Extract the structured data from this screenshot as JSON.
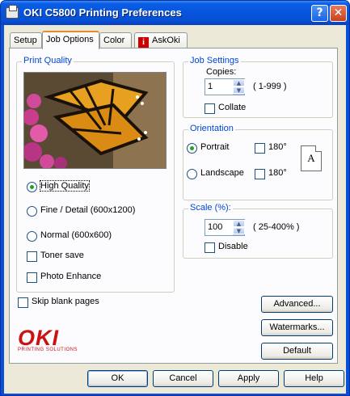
{
  "window": {
    "title": "OKI C5800 Printing Preferences",
    "help_glyph": "?",
    "close_glyph": "✕"
  },
  "tabs": [
    {
      "label": "Setup",
      "active": false
    },
    {
      "label": "Job Options",
      "active": true
    },
    {
      "label": "Color",
      "active": false
    },
    {
      "label": "AskOki",
      "active": false,
      "icon": "info-icon",
      "icon_glyph": "i"
    }
  ],
  "print_quality": {
    "title": "Print Quality",
    "options": [
      {
        "label": "High Quality",
        "selected": true
      },
      {
        "label": "Fine / Detail (600x1200)",
        "selected": false
      },
      {
        "label": "Normal (600x600)",
        "selected": false
      }
    ],
    "toner_save": {
      "label": "Toner save",
      "checked": false
    },
    "photo_enhance": {
      "label": "Photo Enhance",
      "checked": false
    }
  },
  "job_settings": {
    "title": "Job Settings",
    "copies_label": "Copies:",
    "copies_value": "1",
    "copies_range": "( 1-999 )",
    "collate": {
      "label": "Collate",
      "checked": false
    }
  },
  "orientation": {
    "title": "Orientation",
    "portrait": {
      "label": "Portrait",
      "selected": true
    },
    "landscape": {
      "label": "Landscape",
      "selected": false
    },
    "rotate_portrait": {
      "label": "180°",
      "checked": false
    },
    "rotate_landscape": {
      "label": "180°",
      "checked": false
    },
    "preview_glyph": "A"
  },
  "scale": {
    "title": "Scale (%):",
    "value": "100",
    "range": "( 25-400% )",
    "disable": {
      "label": "Disable",
      "checked": false
    }
  },
  "skip_blank": {
    "label": "Skip blank pages",
    "checked": false
  },
  "buttons": {
    "advanced": "Advanced...",
    "watermarks": "Watermarks...",
    "default": "Default"
  },
  "logo": {
    "text": "OKI",
    "sub": "PRINTING SOLUTIONS"
  },
  "footer": {
    "ok": "OK",
    "cancel": "Cancel",
    "apply": "Apply",
    "help": "Help"
  },
  "colors": {
    "titlebar": "#0a5de6",
    "accent_text": "#0046d5",
    "selected_radio": "#21a121",
    "logo_red": "#cc1111"
  }
}
